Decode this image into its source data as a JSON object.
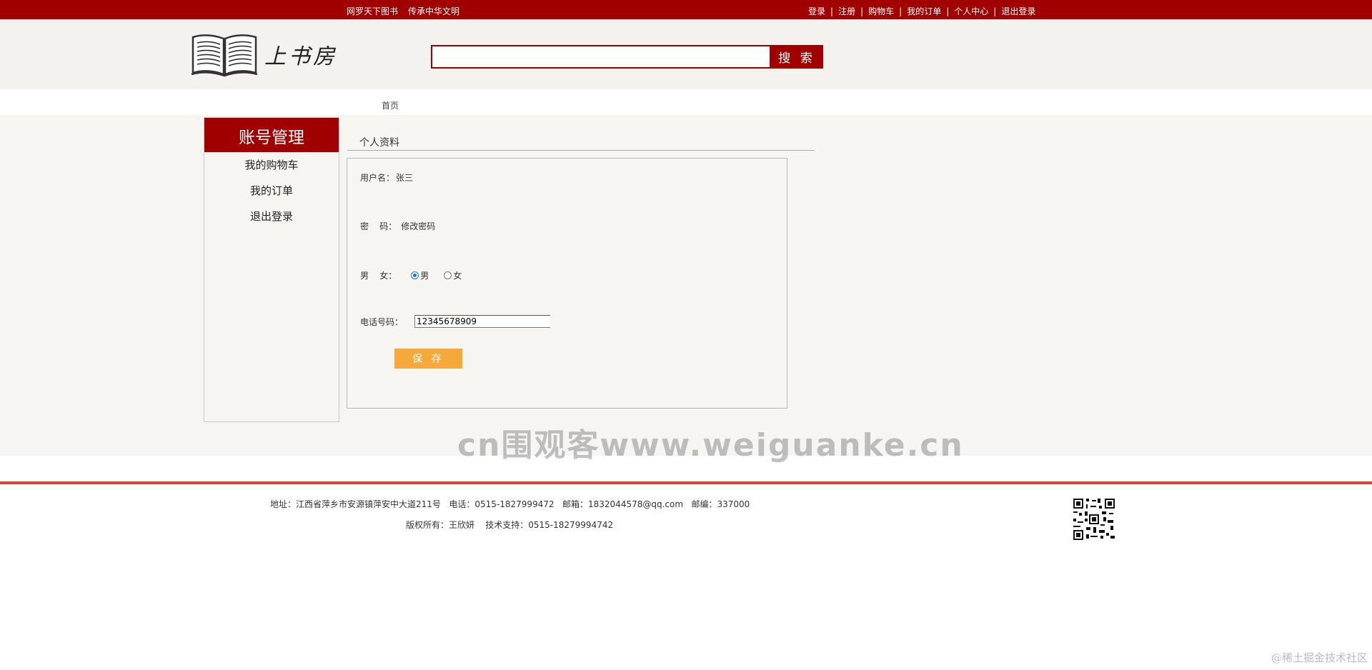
{
  "topbar": {
    "left": [
      "网罗天下图书",
      "传承中华文明"
    ],
    "right": [
      "登录",
      "注册",
      "购物车",
      "我的订单",
      "个人中心",
      "退出登录"
    ],
    "separator": "|"
  },
  "header": {
    "logo_title": "上书房",
    "search": {
      "value": "",
      "placeholder": ""
    },
    "search_button": "搜 索"
  },
  "breadcrumb": {
    "home": "首页"
  },
  "sidebar": {
    "title": "账号管理",
    "items": [
      "我的购物车",
      "我的订单",
      "退出登录"
    ]
  },
  "profile": {
    "section_title": "个人资料",
    "username_label": "用户名：",
    "username_value": "张三",
    "password_label": "密    码：",
    "password_link": "修改密码",
    "gender_label": "男    女：",
    "gender_options": [
      "男",
      "女"
    ],
    "gender_selected": "男",
    "phone_label": "电话号码：",
    "phone_value": "12345678909",
    "save_button": "保 存"
  },
  "watermark": "cn围观客www.weiguanke.cn",
  "footer": {
    "line1": "地址：江西省萍乡市安源镇萍安中大道211号   电话：0515-1827999472   邮箱：1832044578@qq.com   邮编：337000",
    "line2": "版权所有：王欣妍    技术支持：0515-18279994742"
  },
  "credit": "@稀土掘金技术社区",
  "colors": {
    "brand": "#a10000",
    "accent": "#f4a93a",
    "footer_rule": "#d8423c"
  }
}
